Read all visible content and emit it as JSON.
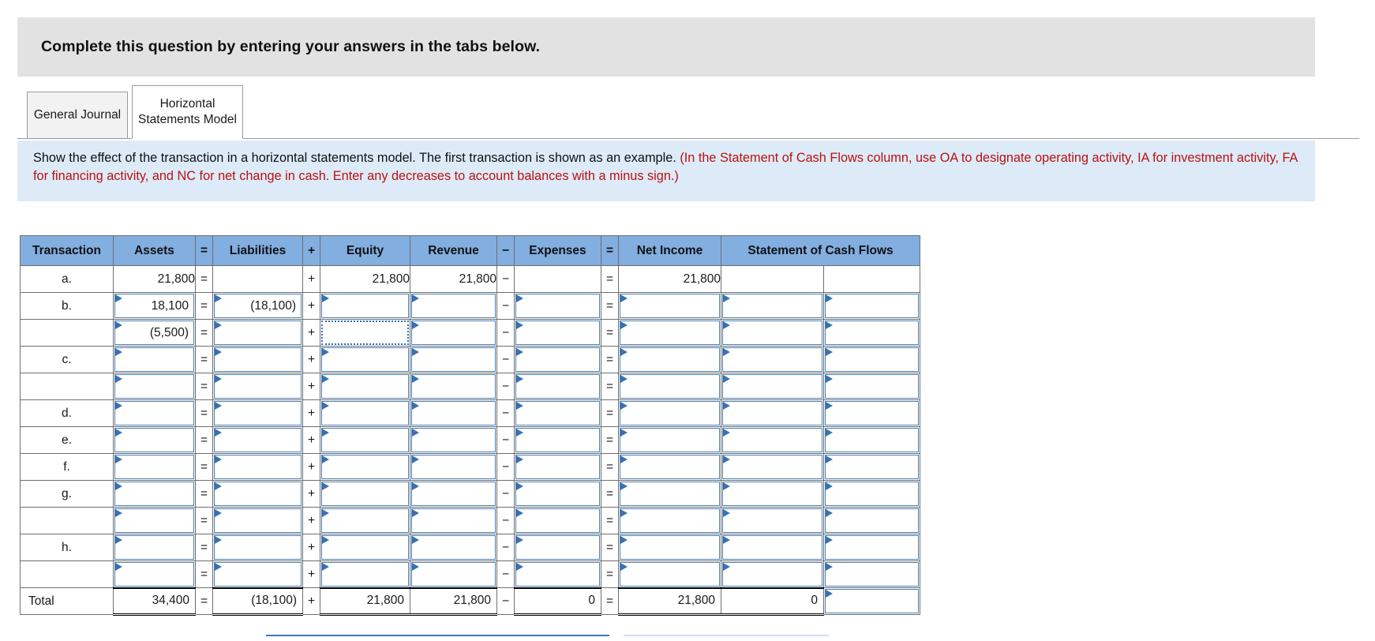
{
  "banner": {
    "text": "Complete this question by entering your answers in the tabs below."
  },
  "tabs": [
    {
      "label": "General Journal",
      "active": false,
      "name": "tab-general-journal"
    },
    {
      "label": "Horizontal Statements Model",
      "active": true,
      "name": "tab-horizontal-statements-model"
    }
  ],
  "instruction": {
    "black_part": "Show the effect of the transaction in a horizontal statements model. The first transaction is shown as an example. ",
    "red_part": "(In the Statement of Cash Flows column, use OA to designate operating activity, IA for investment activity, FA for financing activity, and NC for net change in cash. Enter any decreases to account balances with a minus sign.)"
  },
  "colors": {
    "header_blue": "#82aee0",
    "instruction_bg": "#dcebf7",
    "instruction_red": "#bb1111",
    "banner_gray": "#e2e2e2",
    "cell_border_blue": "#4a7fb5",
    "grid_gray": "#6f6f6f"
  },
  "table": {
    "headers": [
      "Transaction",
      "Assets",
      "=",
      "Liabilities",
      "+",
      "Equity",
      "Revenue",
      "−",
      "Expenses",
      "=",
      "Net Income",
      "Statement of Cash Flows"
    ],
    "operators": {
      "equals": "=",
      "plus": "+",
      "minus": "−"
    },
    "rows": [
      {
        "label": "a.",
        "editable": false,
        "assets": "21,800",
        "liabilities": "",
        "equity": "21,800",
        "revenue": "21,800",
        "expenses": "",
        "net_income": "21,800",
        "cash_flow_1": "",
        "cash_flow_2": ""
      },
      {
        "label": "b.",
        "editable": true,
        "assets": "18,100",
        "liabilities": "(18,100)",
        "equity": "",
        "revenue": "",
        "expenses": "",
        "net_income": "",
        "cash_flow_1": "",
        "cash_flow_2": ""
      },
      {
        "label": "",
        "editable": true,
        "selected_cell": "equity",
        "assets": "(5,500)",
        "liabilities": "",
        "equity": "",
        "revenue": "",
        "expenses": "",
        "net_income": "",
        "cash_flow_1": "",
        "cash_flow_2": ""
      },
      {
        "label": "c.",
        "editable": true,
        "assets": "",
        "liabilities": "",
        "equity": "",
        "revenue": "",
        "expenses": "",
        "net_income": "",
        "cash_flow_1": "",
        "cash_flow_2": ""
      },
      {
        "label": "",
        "editable": true,
        "assets": "",
        "liabilities": "",
        "equity": "",
        "revenue": "",
        "expenses": "",
        "net_income": "",
        "cash_flow_1": "",
        "cash_flow_2": ""
      },
      {
        "label": "d.",
        "editable": true,
        "assets": "",
        "liabilities": "",
        "equity": "",
        "revenue": "",
        "expenses": "",
        "net_income": "",
        "cash_flow_1": "",
        "cash_flow_2": ""
      },
      {
        "label": "e.",
        "editable": true,
        "assets": "",
        "liabilities": "",
        "equity": "",
        "revenue": "",
        "expenses": "",
        "net_income": "",
        "cash_flow_1": "",
        "cash_flow_2": ""
      },
      {
        "label": "f.",
        "editable": true,
        "assets": "",
        "liabilities": "",
        "equity": "",
        "revenue": "",
        "expenses": "",
        "net_income": "",
        "cash_flow_1": "",
        "cash_flow_2": ""
      },
      {
        "label": "g.",
        "editable": true,
        "assets": "",
        "liabilities": "",
        "equity": "",
        "revenue": "",
        "expenses": "",
        "net_income": "",
        "cash_flow_1": "",
        "cash_flow_2": ""
      },
      {
        "label": "",
        "editable": true,
        "assets": "",
        "liabilities": "",
        "equity": "",
        "revenue": "",
        "expenses": "",
        "net_income": "",
        "cash_flow_1": "",
        "cash_flow_2": ""
      },
      {
        "label": "h.",
        "editable": true,
        "assets": "",
        "liabilities": "",
        "equity": "",
        "revenue": "",
        "expenses": "",
        "net_income": "",
        "cash_flow_1": "",
        "cash_flow_2": ""
      },
      {
        "label": "",
        "editable": true,
        "assets": "",
        "liabilities": "",
        "equity": "",
        "revenue": "",
        "expenses": "",
        "net_income": "",
        "cash_flow_1": "",
        "cash_flow_2": ""
      }
    ],
    "total_row": {
      "label": "Total",
      "assets": "34,400",
      "liabilities": "(18,100)",
      "equity": "21,800",
      "revenue": "21,800",
      "expenses": "0",
      "net_income": "21,800",
      "cash_flow_1": "0",
      "cash_flow_2": ""
    }
  }
}
